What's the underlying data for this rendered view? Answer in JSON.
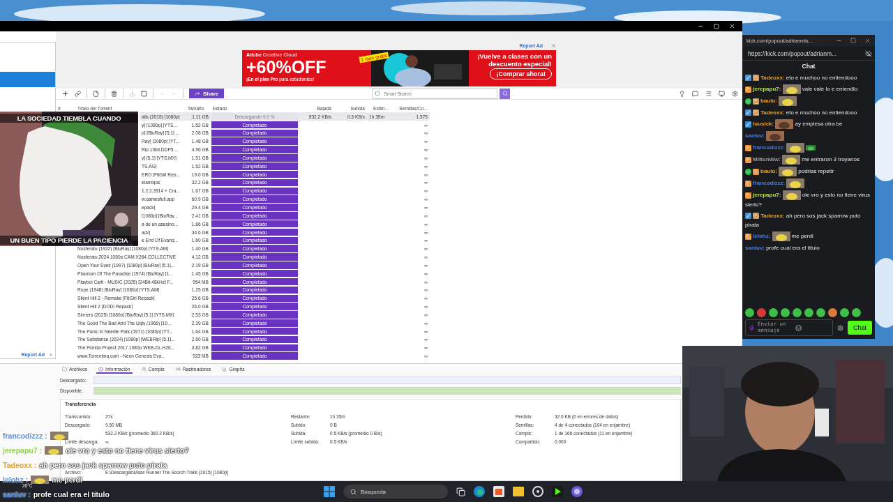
{
  "ad": {
    "report": "Report Ad",
    "brand": "Adobe",
    "product": "Creative Cloud",
    "badge": "1 mes gratis",
    "offer": "+60%OFF",
    "subline": "**¡En el plan Pro** para estudiantes!",
    "headline": "¡Vuelve a clases con un descuento especial!",
    "cta": "¡Comprar ahora!"
  },
  "toolbar": {
    "share": "Share",
    "search": {
      "placeholder": "Smart Search"
    }
  },
  "table": {
    "columns": [
      "#",
      "Título del Torrent",
      "Tamaño",
      "Estado",
      "Bajada",
      "Subida",
      "Estim...",
      "Semillas/Co..."
    ],
    "rows": [
      {
        "title": "ails (2015) [1080p]",
        "size": "1.11 GB",
        "status": "Descargando 0.0 %",
        "kind": "downloading",
        "down": "532.2 KB/s",
        "up": "0.5 KB/s",
        "eta": "1h 35m",
        "seeds": "1.575",
        "selected": true
      },
      {
        "title": "y] [1080p] [YTS...",
        "size": "1.52 GB",
        "status": "Completado",
        "kind": "done",
        "seeds": "∞",
        "selected": false
      },
      {
        "title": "p] [BluRay] [5.1] ...",
        "size": "2.08 GB",
        "status": "Completado",
        "kind": "done",
        "seeds": "∞",
        "selected": false
      },
      {
        "title": "Ray] [1080p] [YT...",
        "size": "1.48 GB",
        "status": "Completado",
        "kind": "done",
        "seeds": "∞",
        "selected": false
      },
      {
        "title": "Rip.10bit.DDP5....",
        "size": "4.96 GB",
        "status": "Completado",
        "kind": "done",
        "seeds": "∞",
        "selected": false
      },
      {
        "title": "y] [5.1] [YTS.MX]",
        "size": "1.91 GB",
        "status": "Completado",
        "kind": "done",
        "seeds": "∞",
        "selected": false
      },
      {
        "title": "TS.AG]",
        "size": "1.52 GB",
        "status": "Completado",
        "kind": "done",
        "seeds": "∞",
        "selected": false
      },
      {
        "title": "ERO [FitGirl Rep...",
        "size": "19.0 GB",
        "status": "Completado",
        "kind": "done",
        "seeds": "∞",
        "selected": false
      },
      {
        "title": "elamigos",
        "size": "32.2 GB",
        "status": "Completado",
        "kind": "done",
        "seeds": "∞",
        "selected": false
      },
      {
        "title": "1.2.2.3914 + Cra...",
        "size": "1.67 GB",
        "status": "Completado",
        "kind": "done",
        "seeds": "∞",
        "selected": false
      },
      {
        "title": "w.gamesfull.app",
        "size": "60.9 GB",
        "status": "Completado",
        "kind": "done",
        "seeds": "∞",
        "selected": false
      },
      {
        "title": "epack]",
        "size": "29.4 GB",
        "status": "Completado",
        "kind": "done",
        "seeds": "∞",
        "selected": false
      },
      {
        "title": "[1080p] [BluRay...",
        "size": "2.41 GB",
        "status": "Completado",
        "kind": "done",
        "seeds": "∞",
        "selected": false
      },
      {
        "title": "a de un asesino...",
        "size": "1.86 GB",
        "status": "Completado",
        "kind": "done",
        "seeds": "∞",
        "selected": false
      },
      {
        "title": "ack]",
        "size": "34.6 GB",
        "status": "Completado",
        "kind": "done",
        "seeds": "∞",
        "selected": false
      },
      {
        "title": "e End Of Evang...",
        "size": "1.60 GB",
        "status": "Completado",
        "kind": "done",
        "seeds": "∞",
        "selected": false
      },
      {
        "title": "Nosferatu (1922) [BluRay] [1080p] [YTS.AM]",
        "size": "1.40 GB",
        "status": "Completado",
        "kind": "done",
        "seeds": "∞",
        "selected": false
      },
      {
        "title": "Nosferatu.2024.1080p.CAM.X264.COLLECTiVE",
        "size": "4.12 GB",
        "status": "Completado",
        "kind": "done",
        "seeds": "∞",
        "selected": false
      },
      {
        "title": "Open Your Eyes (1997) [1080p] [BluRay] [5.1]...",
        "size": "2.19 GB",
        "status": "Completado",
        "kind": "done",
        "seeds": "∞",
        "selected": false
      },
      {
        "title": "Phantom Of The Paradise (1974) [BluRay] [1...",
        "size": "1.45 GB",
        "status": "Completado",
        "kind": "done",
        "seeds": "∞",
        "selected": false
      },
      {
        "title": "Playboi Carti - MUSIC (2025) [24Bit-48kHz] F...",
        "size": "954 MB",
        "status": "Completado",
        "kind": "done",
        "seeds": "∞",
        "selected": false
      },
      {
        "title": "Rope (1948) [BluRay] [1080p] [YTS.AM]",
        "size": "1.25 GB",
        "status": "Completado",
        "kind": "done",
        "seeds": "∞",
        "selected": false
      },
      {
        "title": "Silent Hill 2 - Remake [FitGirl Repack]",
        "size": "25.6 GB",
        "status": "Completado",
        "kind": "done",
        "seeds": "∞",
        "selected": false
      },
      {
        "title": "Silent Hill 2 [DODI Repack]",
        "size": "26.0 GB",
        "status": "Completado",
        "kind": "done",
        "seeds": "∞",
        "selected": false
      },
      {
        "title": "Sinners (2025) [1080p] [BluRay] [5.1] [YTS.MX]",
        "size": "2.53 GB",
        "status": "Completado",
        "kind": "done",
        "seeds": "∞",
        "selected": false
      },
      {
        "title": "The Good The Bad And The Ugly (1966) [10...",
        "size": "2.39 GB",
        "status": "Completado",
        "kind": "done",
        "seeds": "∞",
        "selected": false
      },
      {
        "title": "The Panic In Needle Park (1971) [1080p] [YT...",
        "size": "1.64 GB",
        "status": "Completado",
        "kind": "done",
        "seeds": "∞",
        "selected": false
      },
      {
        "title": "The Substance (2024) [1080p] [WEBRip] [5.1]...",
        "size": "2.60 GB",
        "status": "Completado",
        "kind": "done",
        "seeds": "∞",
        "selected": false
      },
      {
        "title": "The.Florida.Project.2017.1080p.WEB-DL.H26...",
        "size": "3.82 GB",
        "status": "Completado",
        "kind": "done",
        "seeds": "∞",
        "selected": false
      },
      {
        "title": "www.Torrenting.com  -  Neon Genesis Eva...",
        "size": "923 MB",
        "status": "Completado",
        "kind": "done",
        "seeds": "∞",
        "selected": false
      }
    ]
  },
  "left_ad": {
    "report": "Report Ad"
  },
  "details": {
    "tabs": [
      {
        "label": "Archivos",
        "selected": false
      },
      {
        "label": "Información",
        "selected": true
      },
      {
        "label": "Compis",
        "selected": false
      },
      {
        "label": "Rastreadores",
        "selected": false
      },
      {
        "label": "Graphs",
        "selected": false
      }
    ],
    "bars": [
      "Descargado:",
      "Disponible:"
    ],
    "section": "Transferencia",
    "columns": [
      [
        {
          "label": "Transcurrido:",
          "value": "27s"
        },
        {
          "label": "Descargado:",
          "value": "9.50 MB"
        },
        {
          "value": "532.2 KB/s (promedio 360.2 KB/s)"
        },
        {
          "label": "Límite descarga:",
          "value": "∞"
        }
      ],
      [
        {
          "label": "Restante:",
          "value": "1h 35m"
        },
        {
          "label": "Subido:",
          "value": "0 B"
        },
        {
          "label": "Subida:",
          "value": "0.5 KB/s (promedio 0 B/s)"
        },
        {
          "label": "Límite subida:",
          "value": "0.5 KB/s"
        }
      ],
      [
        {
          "label": "Perdido:",
          "value": "32.0 KB (0 en errores de datos)"
        },
        {
          "label": "Semillas:",
          "value": "4 de 4 conectados (104 en enjambre)"
        },
        {
          "label": "Compis:",
          "value": "1 de 166 conectados (11 en enjambre)"
        },
        {
          "label": "Compartido:",
          "value": "0.000"
        }
      ]
    ],
    "file": {
      "label": "Archivo:",
      "value": "E:\\Descargas\\Maze Runner The Scorch Trails (2015) [1080p]"
    }
  },
  "meme": {
    "top": "LA SOCIEDAD TIEMBLA CUANDO",
    "bottom": "UN BUEN TIPO PIERDE LA PACIENCIA"
  },
  "stream_chat": [
    {
      "user": "francodizzz :",
      "color": "#5b8fd6",
      "emote": true
    },
    {
      "user": "jerepapu7 :",
      "color": "#8fd14f",
      "emote": true,
      "text": "oie vro y esto no tiene virus sierto?"
    },
    {
      "user": "Tadeoxx :",
      "color": "#e0a030",
      "emote": false,
      "text": "ah pero sos jack sparrow puto pirata"
    },
    {
      "user": "lelohz :",
      "color": "#5b8fd6",
      "emote": true,
      "text": "me perdi"
    },
    {
      "user": "sanluv :",
      "color": "#3f7fe0",
      "emote": false,
      "text": "profe cual era el título"
    }
  ],
  "kick": {
    "window_title": "kick.com/popout/adrianmis...",
    "url": "https://kick.com/popout/adrianm...",
    "header": "Chat",
    "messages": [
      {
        "user": "Tadeoxx:",
        "color": "#e0a030",
        "badges": [
          {
            "kind": "mod"
          },
          {
            "kind": "sub"
          }
        ],
        "text": "eto e muchoo no entiendooo"
      },
      {
        "user": "jerepapu7:",
        "color": "#b8e04a",
        "badges": [
          {
            "kind": "sub"
          }
        ],
        "emotes": [
          {
            "kind": "face"
          }
        ],
        "text": "vale vale lo e entendio"
      },
      {
        "user": "baulo:",
        "color": "#f0a020",
        "badges": [
          {
            "kind": "verified"
          },
          {
            "kind": "sub"
          }
        ],
        "emotes": [
          {
            "kind": "face"
          }
        ]
      },
      {
        "user": "Tadeoxx:",
        "color": "#e0a030",
        "badges": [
          {
            "kind": "mod"
          },
          {
            "kind": "sub"
          }
        ],
        "text": "eto e muchoo no entiendooo"
      },
      {
        "user": "luusick:",
        "color": "#f0a020",
        "badges": [
          {
            "kind": "mod"
          }
        ],
        "emotes": [
          {
            "kind": "man"
          }
        ],
        "text": "ay empiesa otra be"
      },
      {
        "user": "sanluv:",
        "color": "#4a7fe0",
        "emotes": [
          {
            "kind": "man"
          }
        ]
      },
      {
        "user": "francodizzz:",
        "color": "#4a7fe0",
        "badges": [
          {
            "kind": "sub"
          }
        ],
        "emotes": [
          {
            "kind": "face"
          },
          {
            "kind": "frog"
          }
        ]
      },
      {
        "user": "MiltonWw:",
        "color": "#9a9a9a",
        "badges": [
          {
            "kind": "sub"
          }
        ],
        "emotes": [
          {
            "kind": "face"
          }
        ],
        "text": "me entraron 3 troyanos"
      },
      {
        "user": "baulo:",
        "color": "#f0a020",
        "badges": [
          {
            "kind": "verified"
          },
          {
            "kind": "sub"
          }
        ],
        "emotes": [
          {
            "kind": "face"
          }
        ],
        "text": "podrias repetir"
      },
      {
        "user": "francodizzz:",
        "color": "#4a7fe0",
        "badges": [
          {
            "kind": "sub"
          }
        ],
        "emotes": [
          {
            "kind": "face"
          }
        ]
      },
      {
        "user": "jerepapu7:",
        "color": "#b8e04a",
        "badges": [
          {
            "kind": "sub"
          }
        ],
        "emotes": [
          {
            "kind": "face"
          }
        ],
        "text": "oie vro y esto no tiene virus sierto?"
      },
      {
        "user": "Tadeoxx:",
        "color": "#e0a030",
        "badges": [
          {
            "kind": "mod"
          },
          {
            "kind": "sub"
          }
        ],
        "text": "ah pero sos jack sparrow puto pirata"
      },
      {
        "user": "lelohz:",
        "color": "#4a7fe0",
        "badges": [
          {
            "kind": "sub"
          }
        ],
        "emotes": [
          {
            "kind": "face"
          }
        ],
        "text": "me perdi"
      },
      {
        "user": "sanluv:",
        "color": "#4a7fe0",
        "text": "profe cual era el titulo"
      }
    ],
    "input": {
      "placeholder": "Enviar un mensaje"
    },
    "send": "Chat"
  },
  "taskbar": {
    "weather": "26°C",
    "search": "Búsqueda"
  }
}
